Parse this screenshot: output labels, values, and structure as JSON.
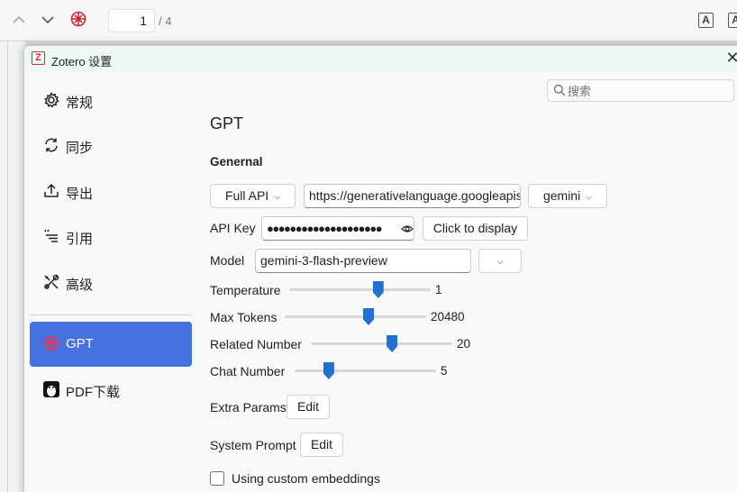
{
  "reader": {
    "page_current": "1",
    "page_total": "/ 4",
    "font_icon_glyph": "A"
  },
  "dialog": {
    "title": "Zotero 设置",
    "logo_glyph": "Z",
    "close_glyph": "✕"
  },
  "sidebar": {
    "items": [
      {
        "label": "常规",
        "icon": "gear-icon"
      },
      {
        "label": "同步",
        "icon": "sync-icon"
      },
      {
        "label": "导出",
        "icon": "export-icon"
      },
      {
        "label": "引用",
        "icon": "cite-icon"
      },
      {
        "label": "高级",
        "icon": "tools-icon"
      },
      {
        "label": "GPT",
        "icon": "openai-icon"
      },
      {
        "label": "PDF下载",
        "icon": "penguin-icon"
      }
    ],
    "active": "GPT"
  },
  "search": {
    "placeholder": "搜索"
  },
  "pane": {
    "title": "GPT",
    "section": "Genernal"
  },
  "api": {
    "mode_label": "Full API",
    "url_value": "https://generativelanguage.googleapis.com",
    "provider_label": "gemini",
    "key_label": "API Key",
    "key_value": "●●●●●●●●●●●●●●●●●●●●",
    "display_button": "Click to display"
  },
  "model": {
    "label": "Model",
    "value": "gemini-3-flash-preview"
  },
  "sliders": [
    {
      "label": "Temperature",
      "value_text": "1",
      "fraction": 0.64
    },
    {
      "label": "Max Tokens",
      "value_text": "20480",
      "fraction": 0.6
    },
    {
      "label": "Related Number",
      "value_text": "20",
      "fraction": 0.58
    },
    {
      "label": "Chat Number",
      "value_text": "5",
      "fraction": 0.22
    }
  ],
  "extra_params": {
    "label": "Extra Params",
    "button": "Edit"
  },
  "system_prompt": {
    "label": "System Prompt",
    "button": "Edit"
  },
  "embeddings": {
    "label": "Using custom embeddings",
    "checked": false
  },
  "colors": {
    "accent": "#4672e0",
    "slider": "#1f72d1",
    "zotero_red": "#cc2936"
  }
}
